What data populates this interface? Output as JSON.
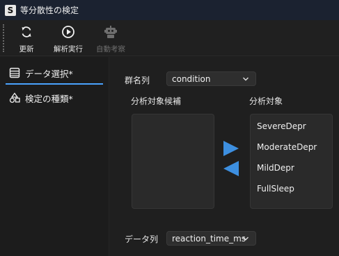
{
  "window": {
    "title": "等分散性の検定",
    "logo_letter": "S"
  },
  "toolbar": {
    "buttons": [
      {
        "label": "更新",
        "icon": "refresh-icon",
        "enabled": true
      },
      {
        "label": "解析実行",
        "icon": "play-icon",
        "enabled": true
      },
      {
        "label": "自動考察",
        "icon": "robot-icon",
        "enabled": false
      }
    ]
  },
  "sidebar": {
    "items": [
      {
        "label": "データ選択*",
        "icon": "table-icon",
        "active": true
      },
      {
        "label": "検定の種類*",
        "icon": "shapes-icon",
        "active": false
      }
    ]
  },
  "main": {
    "group_label": "群名列",
    "group_value": "condition",
    "candidates_label": "分析対象候補",
    "targets_label": "分析対象",
    "candidates": [],
    "targets": [
      "SevereDepr",
      "ModerateDepr",
      "MildDepr",
      "FullSleep"
    ],
    "data_label": "データ列",
    "data_value": "reaction_time_ms"
  },
  "colors": {
    "accent": "#4aa3ff",
    "arrow": "#3d8fe0"
  }
}
